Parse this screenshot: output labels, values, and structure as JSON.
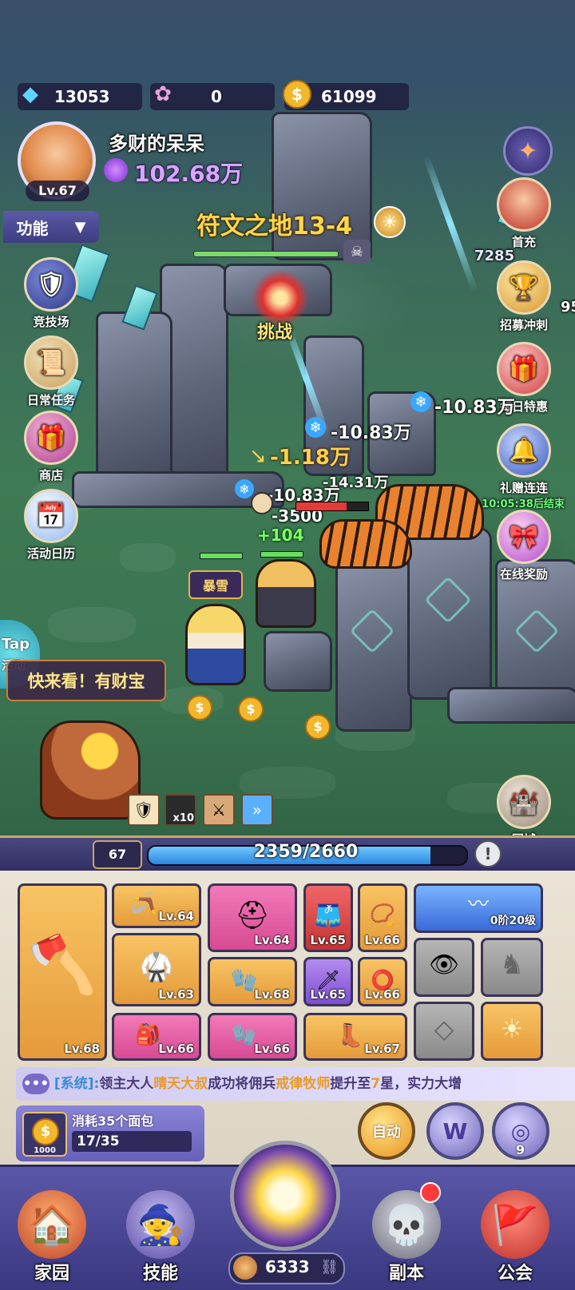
{
  "resources": {
    "diamonds": "13053",
    "gems": "0",
    "gold": "61099"
  },
  "player": {
    "name": "多财的呆呆",
    "level": "Lv.67",
    "power": "102.68万"
  },
  "features_toggle": "功能",
  "left_menu": [
    {
      "label": "竞技场",
      "icon": "shield-icon"
    },
    {
      "label": "日常任务",
      "icon": "scroll-icon"
    },
    {
      "label": "商店",
      "icon": "chest-icon"
    },
    {
      "label": "活动日历",
      "icon": "calendar-icon"
    }
  ],
  "right_menu": [
    {
      "label": "首充",
      "icon": "hero-portrait-icon"
    },
    {
      "label": "招募冲刺",
      "icon": "trophy-icon"
    },
    {
      "label": "每日特惠",
      "icon": "gift-icon"
    },
    {
      "label": "礼赠连连",
      "icon": "bell-gift-icon",
      "timer": "10:05:38后结束"
    },
    {
      "label": "在线奖励",
      "icon": "present-icon"
    }
  ],
  "stage": {
    "title": "符文之地13-4",
    "challenge": "挑战"
  },
  "battle": {
    "damage": [
      "-10.83万",
      "-10.83万",
      "-1.18万",
      "-14.31万",
      "-10.83万",
      "-3500"
    ],
    "heal": "+104",
    "partial_left": "7285",
    "partial_right": "95",
    "hero_tag": "暴雪"
  },
  "tap_activity": {
    "line1": "Tap",
    "line2": "活动"
  },
  "treasure_bubble": "快来看！有财宝",
  "buff_count": "x10",
  "return_city": "回城",
  "exp": {
    "level": "67",
    "text": "2359/2660",
    "progress": 0.887
  },
  "equipment": {
    "weapon_level": "Lv.68",
    "slots": [
      {
        "level": "Lv.64",
        "icon": "boomerang-icon"
      },
      {
        "level": "Lv.64",
        "icon": "antler-helmet-icon"
      },
      {
        "level": "Lv.65",
        "icon": "shorts-icon"
      },
      {
        "level": "Lv.66",
        "icon": "necklace-icon"
      },
      {
        "level": "Lv.63",
        "icon": "armor-icon"
      },
      {
        "level": "Lv.68",
        "icon": "bracer-icon"
      },
      {
        "level": "Lv.65",
        "icon": "sword-card-icon"
      },
      {
        "level": "Lv.66",
        "icon": "bracelet-icon"
      },
      {
        "level": "Lv.66",
        "icon": "belt-icon"
      },
      {
        "level": "Lv.66",
        "icon": "glove-icon"
      },
      {
        "level": "Lv.67",
        "icon": "boots-icon"
      }
    ]
  },
  "wings": {
    "label": "0阶20级"
  },
  "system_message": {
    "prefix": "[系统]:",
    "t1": "领主大人",
    "name1": "晴天大叔",
    "t2": "成功将佣兵",
    "name2": "戒律牧师",
    "t3": "提升至",
    "num": "7",
    "t4": "星，实力大增"
  },
  "consume": {
    "label": "消耗35个面包",
    "progress_text": "17/35",
    "coin_value": "1000"
  },
  "auto_button": "自动",
  "w_button": "W",
  "speed_badge": "9",
  "bread_count": "6333",
  "bottom_nav": [
    {
      "label": "家园",
      "icon": "house-icon"
    },
    {
      "label": "技能",
      "icon": "hooded-mage-icon"
    },
    {
      "label": "副本",
      "icon": "horned-skull-icon"
    },
    {
      "label": "公会",
      "icon": "banner-icon"
    }
  ]
}
